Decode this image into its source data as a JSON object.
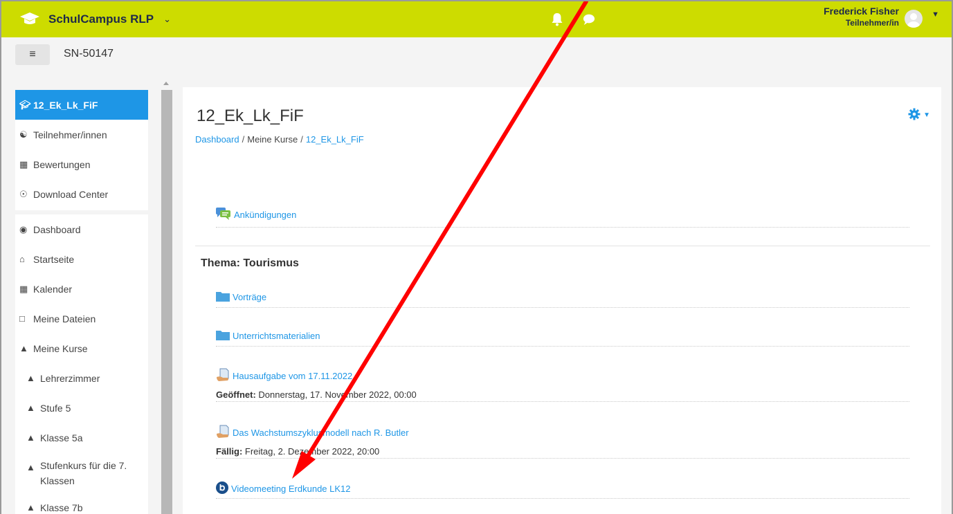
{
  "navbar": {
    "brand_name": "SchulCampus RLP",
    "brand_color": "#cddc00",
    "icons": [
      "bell-icon",
      "chat-icon"
    ],
    "user_name": "Frederick Fisher",
    "user_role": "Teilnehmer/in"
  },
  "subbar": {
    "site_short": "SN-50147"
  },
  "drawer": {
    "course_items": [
      {
        "label": "12_Ek_Lk_FiF",
        "icon": "graduation-cap-icon",
        "active": true
      },
      {
        "label": "Teilnehmer/innen",
        "icon": "users-icon"
      },
      {
        "label": "Bewertungen",
        "icon": "table-icon"
      },
      {
        "label": "Download Center",
        "icon": "download-icon"
      }
    ],
    "site_items": [
      {
        "label": "Dashboard",
        "icon": "dashboard-icon"
      },
      {
        "label": "Startseite",
        "icon": "home-icon"
      },
      {
        "label": "Kalender",
        "icon": "calendar-icon"
      },
      {
        "label": "Meine Dateien",
        "icon": "file-icon"
      },
      {
        "label": "Meine Kurse",
        "icon": "graduation-cap-icon"
      },
      {
        "label": "Lehrerzimmer",
        "icon": "graduation-cap-icon"
      },
      {
        "label": "Stufe 5",
        "icon": "graduation-cap-icon"
      },
      {
        "label": "Klasse 5a",
        "icon": "graduation-cap-icon"
      },
      {
        "label": "Stufenkurs für die 7. Klassen",
        "icon": "graduation-cap-icon"
      },
      {
        "label": "Klasse 7b",
        "icon": "graduation-cap-icon"
      }
    ]
  },
  "main": {
    "title": "12_Ek_Lk_FiF",
    "breadcrumb": {
      "dashboard": "Dashboard",
      "sep": "/",
      "my_courses": "Meine Kurse",
      "course": "12_Ek_Lk_FiF"
    },
    "announcements": "Ankündigungen",
    "section_title": "Thema: Tourismus",
    "activities": [
      {
        "label": "Vorträge",
        "icon": "folder-icon"
      },
      {
        "label": "Unterrichtsmaterialien",
        "icon": "folder-icon"
      },
      {
        "label": "Hausaufgabe vom 17.11.2022",
        "icon": "assignment-icon",
        "meta_label": "Geöffnet:",
        "meta_value": " Donnerstag, 17. November 2022, 00:00"
      },
      {
        "label": "Das Wachstumszyklusmodell nach R. Butler",
        "icon": "assignment-icon",
        "meta_label": "Fällig:",
        "meta_value": " Freitag, 2. Dezember 2022, 20:00"
      },
      {
        "label": "Videomeeting Erdkunde LK12",
        "icon": "bigbluebutton-icon"
      }
    ]
  },
  "annotation": {
    "arrow_color": "#ff0000"
  }
}
